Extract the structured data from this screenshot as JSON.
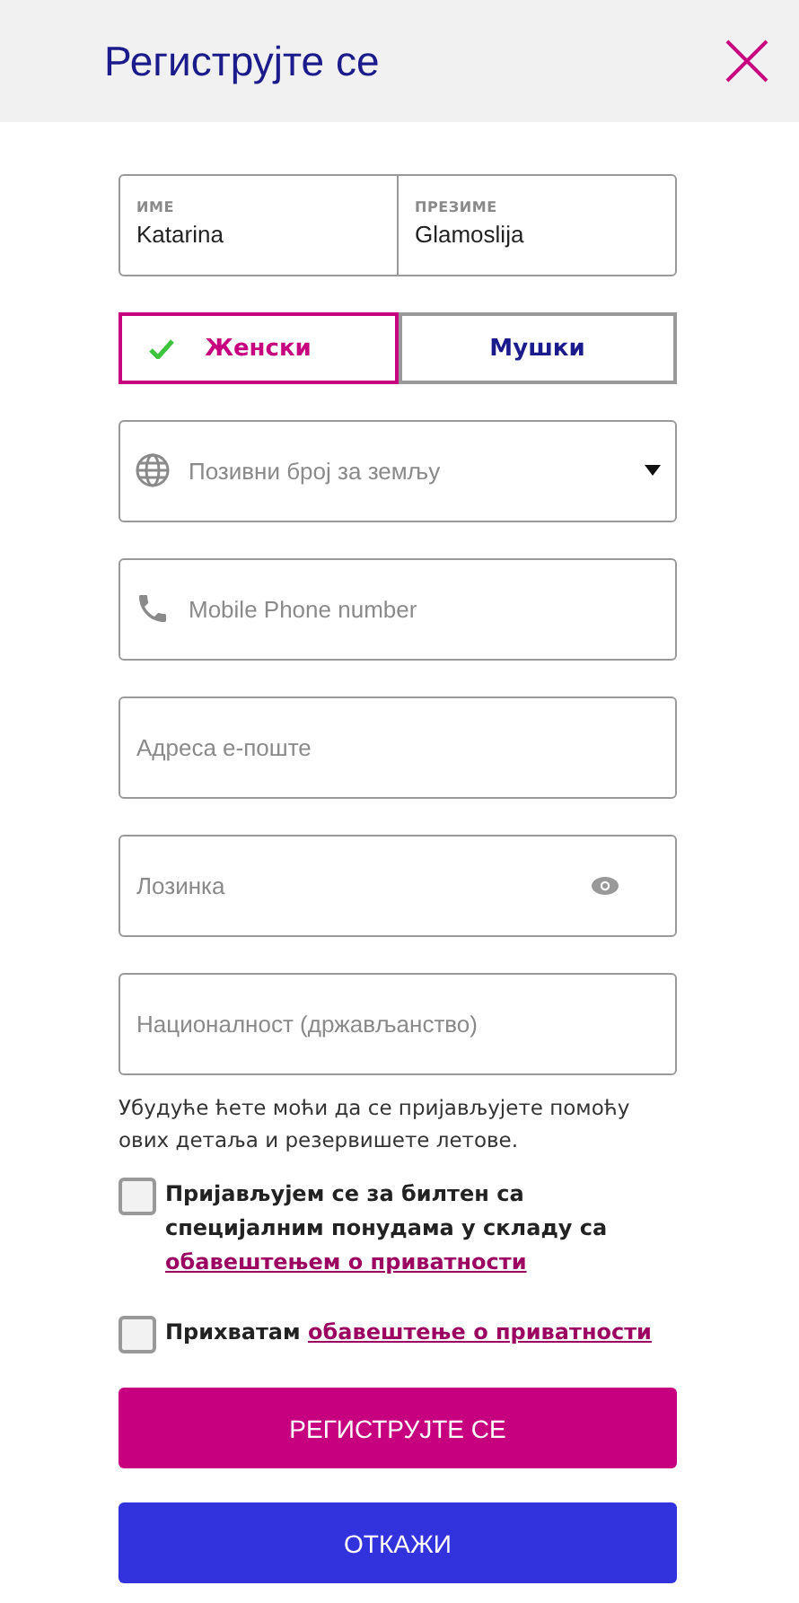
{
  "header": {
    "title": "Региструјте се"
  },
  "name_fields": [
    {
      "label": "ИМЕ",
      "value": "Katarina"
    },
    {
      "label": "ПРЕЗИМЕ",
      "value": "Glamoslija"
    }
  ],
  "gender": [
    {
      "label": "Женски",
      "selected": true
    },
    {
      "label": "Мушки",
      "selected": false
    }
  ],
  "fields": [
    {
      "kind": "country",
      "placeholder": "Позивни број за земљу"
    },
    {
      "kind": "phone",
      "placeholder": "Mobile Phone number"
    },
    {
      "kind": "text",
      "placeholder": "Адреса е-поште"
    },
    {
      "kind": "password",
      "placeholder": "Лозинка"
    },
    {
      "kind": "text",
      "placeholder": "Националност (држављанство)"
    }
  ],
  "info_text": "Убудуће ћете моћи да се пријављујете помоћу ових детаља и резервишете летове.",
  "consents": [
    {
      "checked": false,
      "text": "Пријављујем се за билтен са специјалним понудама у складу са",
      "link": "обавештењем о приватности"
    },
    {
      "checked": false,
      "text": "Прихватам",
      "link": "обавештење о приватности"
    }
  ],
  "buttons": [
    {
      "kind": "primary",
      "label": "РЕГИСТРУЈТЕ СЕ"
    },
    {
      "kind": "secondary",
      "label": "ОТКАЖИ"
    }
  ]
}
